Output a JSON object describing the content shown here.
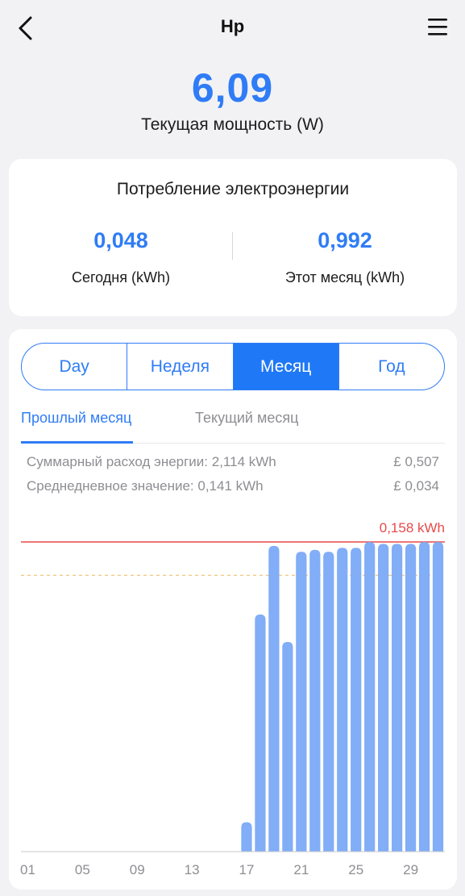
{
  "header": {
    "title": "Hp"
  },
  "power": {
    "value": "6,09",
    "label": "Текущая мощность (W)"
  },
  "consumption": {
    "title": "Потребление электроэнергии",
    "today": {
      "value": "0,048",
      "label": "Сегодня (kWh)"
    },
    "month": {
      "value": "0,992",
      "label": "Этот месяц (kWh)"
    }
  },
  "period_tabs": [
    {
      "label": "Day",
      "active": false
    },
    {
      "label": "Неделя",
      "active": false
    },
    {
      "label": "Месяц",
      "active": true
    },
    {
      "label": "Год",
      "active": false
    }
  ],
  "sub_tabs": {
    "previous": "Прошлый месяц",
    "current": "Текущий месяц",
    "active": "previous"
  },
  "summary": {
    "total_label": "Суммарный расход энергии: 2,114 kWh",
    "total_cost": "£ 0,507",
    "avg_label": "Среднедневное значение: 0,141 kWh",
    "avg_cost": "£ 0,034"
  },
  "colors": {
    "accent": "#2f7cf6",
    "bar": "#82adf7",
    "max_line": "#e84a4a",
    "avg_line": "#f0c070"
  },
  "chart_data": {
    "type": "bar",
    "max_label": "0,158 kWh",
    "max_value": 0.158,
    "avg_value": 0.141,
    "ylim": [
      0,
      0.158
    ],
    "x_tick_labels": [
      "01",
      "05",
      "09",
      "13",
      "17",
      "21",
      "25",
      "29"
    ],
    "categories": [
      "01",
      "02",
      "03",
      "04",
      "05",
      "06",
      "07",
      "08",
      "09",
      "10",
      "11",
      "12",
      "13",
      "14",
      "15",
      "16",
      "17",
      "18",
      "19",
      "20",
      "21",
      "22",
      "23",
      "24",
      "25",
      "26",
      "27",
      "28",
      "29",
      "30",
      "31"
    ],
    "values": [
      0,
      0,
      0,
      0,
      0,
      0,
      0,
      0,
      0,
      0,
      0,
      0,
      0,
      0,
      0,
      0,
      0.015,
      0.121,
      0.156,
      0.107,
      0.153,
      0.154,
      0.153,
      0.155,
      0.155,
      0.158,
      0.157,
      0.157,
      0.157,
      0.158,
      0.158
    ]
  }
}
